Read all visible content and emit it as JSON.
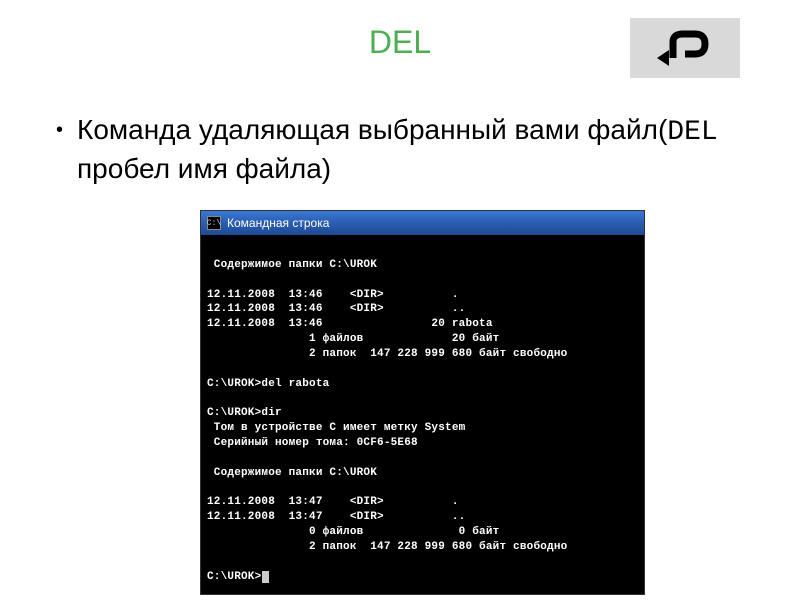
{
  "title": "DEL",
  "backButton": {
    "name": "back-arrow"
  },
  "bullet": {
    "text_part1": "Команда удаляющая выбранный вами файл(",
    "text_code": "DEL",
    "text_part2": " пробел имя файла)"
  },
  "console": {
    "titlebarIconGlyph": "C:\\",
    "titlebarText": "Командная строка",
    "lines": [
      "",
      " Содержимое папки C:\\UROK",
      "",
      "12.11.2008  13:46    <DIR>          .",
      "12.11.2008  13:46    <DIR>          ..",
      "12.11.2008  13:46                20 rabota",
      "               1 файлов             20 байт",
      "               2 папок  147 228 999 680 байт свободно",
      "",
      "C:\\UROK>del rabota",
      "",
      "C:\\UROK>dir",
      " Том в устройстве C имеет метку System",
      " Серийный номер тома: 0CF6-5E68",
      "",
      " Содержимое папки C:\\UROK",
      "",
      "12.11.2008  13:47    <DIR>          .",
      "12.11.2008  13:47    <DIR>          ..",
      "               0 файлов              0 байт",
      "               2 папок  147 228 999 680 байт свободно",
      "",
      "C:\\UROK>"
    ]
  }
}
